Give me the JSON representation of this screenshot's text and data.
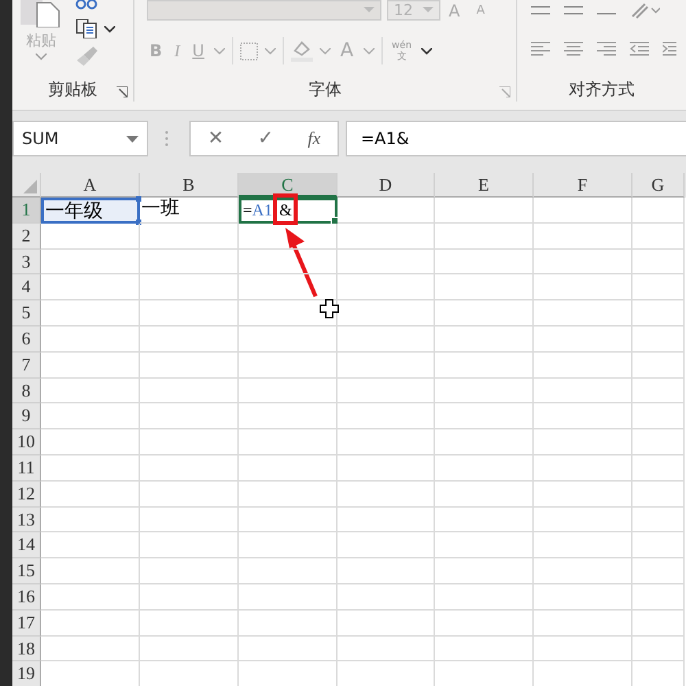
{
  "ribbon": {
    "clipboard": {
      "paste_label": "粘贴",
      "group_label": "剪贴板"
    },
    "font": {
      "font_size": "12",
      "grow": "A",
      "shrink": "A",
      "bold": "B",
      "italic": "I",
      "underline": "U",
      "font_color": "A",
      "phonetic_top": "wén",
      "phonetic_bottom": "文",
      "group_label": "字体"
    },
    "alignment": {
      "group_label": "对齐方式"
    }
  },
  "formula_bar": {
    "name_box": "SUM",
    "cancel": "✕",
    "enter": "✓",
    "function": "fx",
    "formula": "=A1&"
  },
  "columns": [
    {
      "label": "A",
      "selected": false
    },
    {
      "label": "B",
      "selected": false
    },
    {
      "label": "C",
      "selected": true
    },
    {
      "label": "D",
      "selected": false
    },
    {
      "label": "E",
      "selected": false
    },
    {
      "label": "F",
      "selected": false
    },
    {
      "label": "G",
      "selected": false
    }
  ],
  "rows": [
    {
      "label": "1",
      "selected": true,
      "cells": [
        {
          "kind": "ref_range",
          "text": "一年级"
        },
        {
          "kind": "text",
          "text": "一班"
        },
        {
          "kind": "editing",
          "parts": [
            {
              "kind": "text",
              "text": "="
            },
            {
              "kind": "ref",
              "text": "A1"
            },
            {
              "kind": "highlight",
              "text": "&"
            }
          ]
        }
      ]
    },
    {
      "label": "2",
      "selected": false
    },
    {
      "label": "3",
      "selected": false
    },
    {
      "label": "4",
      "selected": false
    },
    {
      "label": "5",
      "selected": false
    },
    {
      "label": "6",
      "selected": false
    },
    {
      "label": "7",
      "selected": false
    },
    {
      "label": "8",
      "selected": false
    },
    {
      "label": "9",
      "selected": false
    },
    {
      "label": "10",
      "selected": false
    },
    {
      "label": "11",
      "selected": false
    },
    {
      "label": "12",
      "selected": false
    },
    {
      "label": "13",
      "selected": false
    },
    {
      "label": "14",
      "selected": false
    },
    {
      "label": "15",
      "selected": false
    },
    {
      "label": "16",
      "selected": false
    },
    {
      "label": "17",
      "selected": false
    },
    {
      "label": "18",
      "selected": false
    },
    {
      "label": "19",
      "selected": false
    }
  ]
}
